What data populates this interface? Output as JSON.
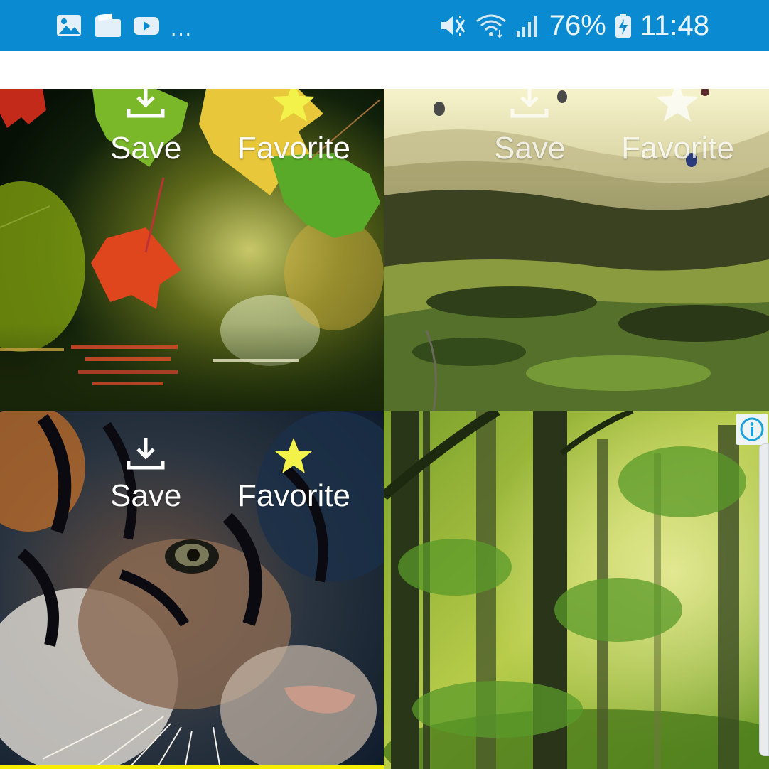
{
  "status_bar": {
    "left_icons": [
      "gallery-icon",
      "folder-icon",
      "youtube-icon"
    ],
    "more_indicator": "...",
    "right_icons": [
      "vibrate-mute-icon",
      "wifi-icon",
      "signal-icon",
      "battery-charging-icon"
    ],
    "battery_percent": "76%",
    "time": "11:48",
    "background_color": "#0a8ad0"
  },
  "wallpapers": [
    {
      "scene": "autumn leaves over water",
      "save_label": "Save",
      "favorite_label": "Favorite",
      "favorite_active": true,
      "favorite_color": "#f2f24a"
    },
    {
      "scene": "hills with hot air balloons",
      "save_label": "Save",
      "favorite_label": "Favorite",
      "favorite_active": false,
      "favorite_color": "#ffffff"
    },
    {
      "scene": "tiger face",
      "save_label": "Save",
      "favorite_label": "Favorite",
      "favorite_active": true,
      "favorite_color": "#f2f24a"
    },
    {
      "scene": "green misty forest",
      "has_ad_info_icon": true
    }
  ],
  "colors": {
    "accent_yellow": "#f5ee00",
    "info_icon": "#1aa3d9"
  }
}
